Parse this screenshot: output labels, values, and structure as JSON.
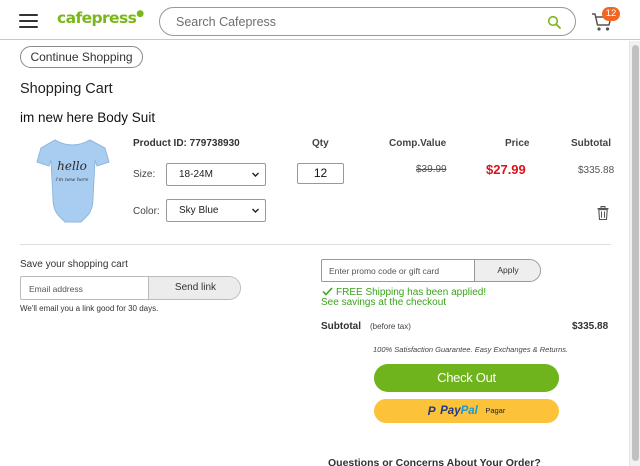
{
  "header": {
    "logo": "cafepress",
    "logo_mark": "●",
    "search_placeholder": "Search Cafepress",
    "cart_count": "12"
  },
  "nav": {
    "continue_label": "Continue Shopping"
  },
  "cart": {
    "title": "Shopping Cart",
    "product_name": "im new here Body Suit",
    "image_text_main": "hello",
    "image_text_sub": "i'm new here",
    "product_id_label": "Product ID:",
    "product_id": "779738930",
    "columns": {
      "qty": "Qty",
      "comp_value": "Comp.Value",
      "price": "Price",
      "subtotal": "Subtotal"
    },
    "size_label": "Size:",
    "size_value": "18-24M",
    "color_label": "Color:",
    "color_value": "Sky Blue",
    "qty_value": "12",
    "comp_value": "$39.99",
    "price": "$27.99",
    "subtotal": "$335.88"
  },
  "save_cart": {
    "title": "Save your shopping cart",
    "email_placeholder": "Email address",
    "send_label": "Send link",
    "note": "We'll email you a link good for 30 days."
  },
  "summary": {
    "promo_placeholder": "Enter promo code or gift card",
    "apply_label": "Apply",
    "shipping_msg": "FREE Shipping has been applied!",
    "savings_link": "See savings at the checkout",
    "subtotal_label": "Subtotal",
    "subtotal_note": "(before tax)",
    "subtotal_value": "$335.88",
    "guarantee": "100% Satisfaction Guarantee. Easy Exchanges & Returns.",
    "checkout_label": "Check Out",
    "paypal_p": "P",
    "paypal_pay": "Pay",
    "paypal_pal": "Pal",
    "paypal_pagar": "Pagar",
    "questions": "Questions or Concerns About Your Order?"
  },
  "colors": {
    "brand_green": "#79b71b",
    "checkout_green": "#6fb31d",
    "price_red": "#d8131c",
    "badge_orange": "#f26522",
    "paypal_yellow": "#fcc33a",
    "product_blue": "#a9cdf0"
  },
  "icons": {
    "menu": "hamburger-icon",
    "search": "search-icon",
    "cart": "cart-icon",
    "delete": "trash-icon",
    "check": "check-icon"
  }
}
